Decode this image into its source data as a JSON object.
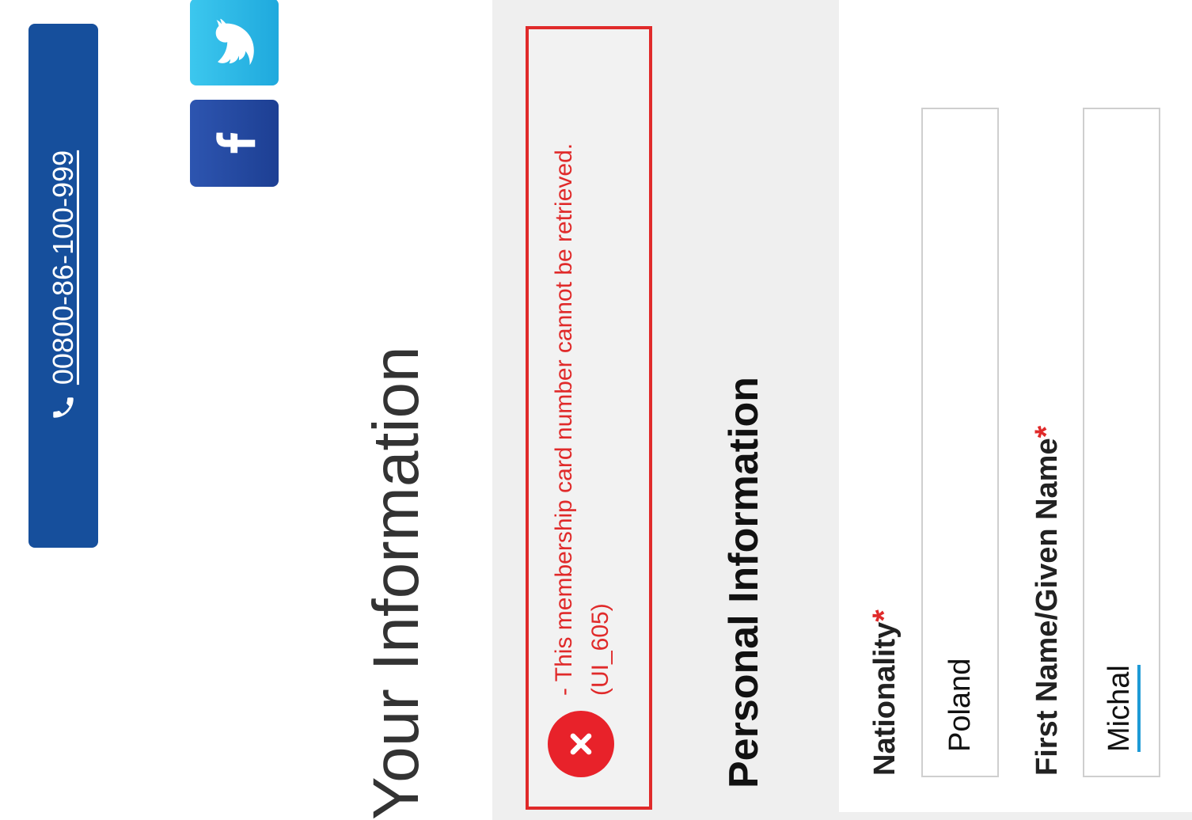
{
  "header": {
    "phone_number": "00800-86-100-999",
    "phone_icon": "phone-icon"
  },
  "social": [
    {
      "name": "twitter",
      "icon": "twitter-bird-icon",
      "color": "#2bb9e8"
    },
    {
      "name": "facebook",
      "icon": "facebook-f-icon",
      "color": "#2348a3"
    }
  ],
  "page": {
    "title": "Your Information"
  },
  "error": {
    "icon": "error-x-icon",
    "message": "- This membership card number cannot be retrieved. (UI_605)",
    "color": "#e02a2a"
  },
  "personal": {
    "section_title": "Personal Information",
    "fields": [
      {
        "label": "Nationality",
        "required_mark": "*",
        "value": "Poland"
      },
      {
        "label": "First Name/Given Name",
        "required_mark": "*",
        "value": "Michal"
      }
    ]
  }
}
